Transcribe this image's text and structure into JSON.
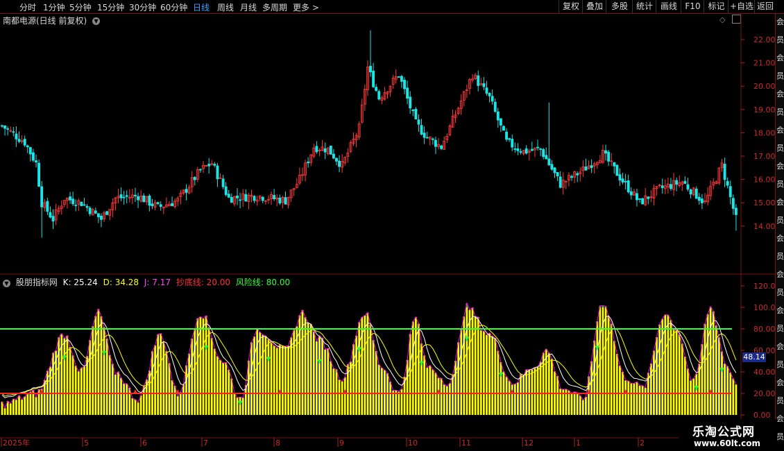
{
  "toolbar": {
    "periods": [
      "分时",
      "1分钟",
      "5分钟",
      "15分钟",
      "30分钟",
      "60分钟",
      "日线",
      "周线",
      "月线",
      "多周期",
      "更多 >"
    ],
    "active_period": "日线",
    "right_buttons": [
      "复权",
      "叠加",
      "多股",
      "统计",
      "画线",
      "F10",
      "标记",
      "+自选",
      "返回"
    ]
  },
  "main_chart": {
    "title": "南都电源(日线 前复权)",
    "y_ticks": [
      "22.00",
      "21.00",
      "20.00",
      "19.00",
      "18.00",
      "17.00",
      "16.00",
      "15.00",
      "14.00"
    ],
    "y_values": [
      22,
      21,
      20,
      19,
      18,
      17,
      16,
      15,
      14
    ],
    "up_color": "#ff3b3b",
    "down_color": "#19e6e6"
  },
  "indicator": {
    "name": "股朋指标网",
    "k_label": "K: 25.24",
    "d_label": "D: 34.28",
    "j_label": "J: 7.17",
    "buy_line_label": "抄底线: 20.00",
    "risk_line_label": "风险线: 80.00",
    "y_ticks": [
      "120.0",
      "100.0",
      "80.00",
      "60.00",
      "40.00",
      "20.00",
      "0.00"
    ],
    "y_values": [
      120,
      100,
      80,
      60,
      40,
      20,
      0
    ],
    "current_value_label": "48.14",
    "colors": {
      "k": "#ffffff",
      "d": "#ffff00",
      "j": "#ff00ff",
      "buy_line": "#ff2020",
      "risk_line": "#33ff33",
      "bar": "#ffff00"
    }
  },
  "x_axis": {
    "labels": [
      "2025年",
      "5",
      "6",
      "7",
      "8",
      "9",
      "10",
      "11",
      "12",
      "1",
      "2"
    ]
  },
  "side_panel_text": "会员",
  "watermark": {
    "line1": "乐淘公式网",
    "line2": "www.60lt.com"
  },
  "pane_icons": [
    "diamond-icon",
    "close-icon"
  ]
}
